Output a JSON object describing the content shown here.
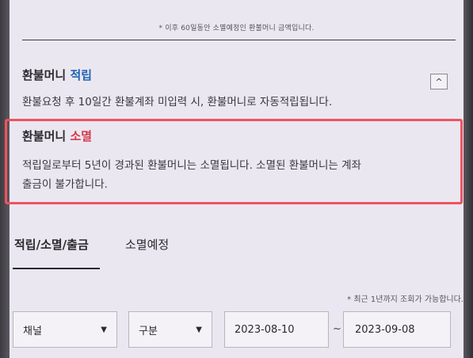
{
  "top_notice": "* 이후 60일동안 소멸예정인 환불머니 금액입니다.",
  "accrual": {
    "title_prefix": "환불머니 ",
    "title_accent": "적립",
    "toggle_symbol": "^",
    "description": "환불요청 후 10일간 환불계좌 미입력 시, 환불머니로 자동적립됩니다."
  },
  "expiry": {
    "title_prefix": "환불머니 ",
    "title_accent": "소멸",
    "description_line1": "적립일로부터 5년이 경과된 환불머니는 소멸됩니다. 소멸된 환불머니는 계좌",
    "description_line2": "출금이 불가합니다."
  },
  "tabs": [
    {
      "label": "적립/소멸/출금",
      "active": true
    },
    {
      "label": "소멸예정",
      "active": false
    }
  ],
  "query_hint": "* 최근 1년까지 조회가 가능합니다.",
  "filters": {
    "channel": {
      "selected": "채널"
    },
    "type": {
      "selected": "구분"
    },
    "date_from": "2023-08-10",
    "date_separator": "~",
    "date_to": "2023-09-08"
  },
  "icons": {
    "dropdown_caret": "▼"
  },
  "colors": {
    "accent_blue": "#2164b6",
    "accent_red": "#d7384a",
    "highlight_border": "#ef5360"
  }
}
